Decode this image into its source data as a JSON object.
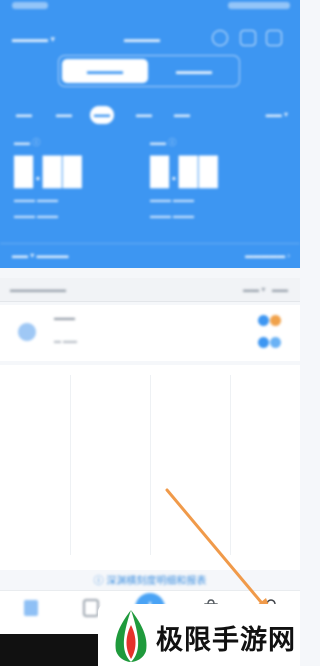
{
  "header": {
    "tabs": [
      {
        "label": "",
        "active": true
      },
      {
        "label": "",
        "active": false
      }
    ],
    "periods": [
      "",
      "",
      "",
      "",
      "",
      ""
    ],
    "period_active_index": 2
  },
  "footer": {
    "link_text": "ⓘ 深渊横刻度明细和报表"
  },
  "bottom_nav": {
    "items": [
      {
        "icon": "home-icon"
      },
      {
        "icon": "document-icon"
      },
      {
        "icon": "plus-icon"
      },
      {
        "icon": "bag-icon"
      },
      {
        "icon": "profile-icon"
      }
    ]
  },
  "annotation": {
    "color": "#f09a4a",
    "target": "profile-icon"
  },
  "watermark": {
    "text": "极限手游网",
    "logo_colors": [
      "#1f9a3c",
      "#e4322b"
    ]
  }
}
